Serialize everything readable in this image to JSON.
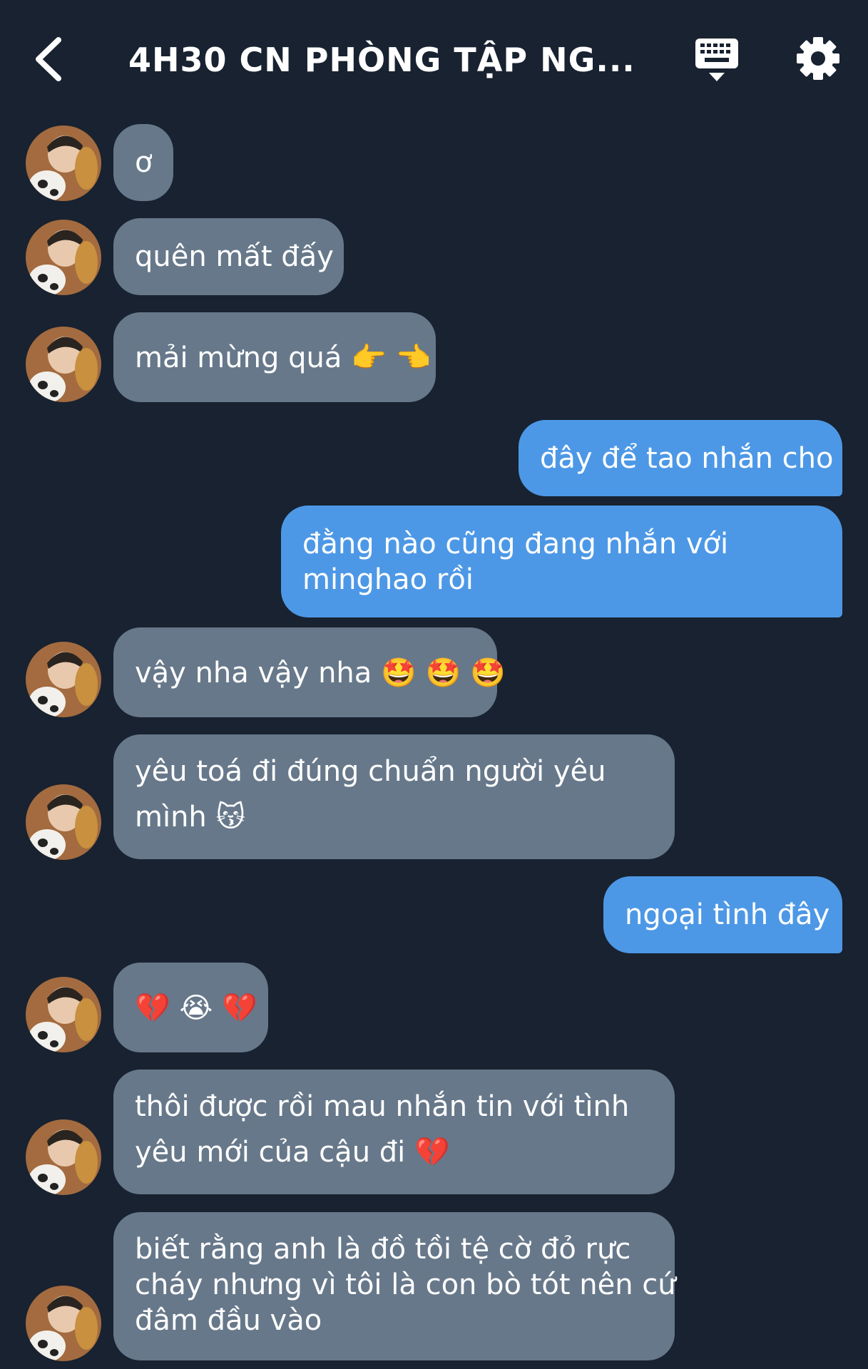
{
  "header": {
    "title": "4H30 CN PHÒNG TẬP NG...",
    "back_icon": "chevron-left-icon",
    "keyboard_icon": "keyboard-icon",
    "settings_icon": "gear-icon"
  },
  "colors": {
    "background": "#182230",
    "incoming_bubble": "#67788a",
    "outgoing_bubble": "#4d98e6",
    "text": "#ffffff"
  },
  "messages": [
    {
      "direction": "incoming",
      "lines": [
        "ơ"
      ]
    },
    {
      "direction": "incoming",
      "lines": [
        "quên mất đấy"
      ]
    },
    {
      "direction": "incoming",
      "lines": [
        "mải mừng quá 👉 👈"
      ]
    },
    {
      "direction": "outgoing",
      "lines": [
        "đây để tao nhắn cho"
      ]
    },
    {
      "direction": "outgoing",
      "lines": [
        "đằng nào cũng đang nhắn với",
        "minghao rồi"
      ]
    },
    {
      "direction": "incoming",
      "lines": [
        "vậy nha vậy nha 🤩 🤩 🤩"
      ]
    },
    {
      "direction": "incoming",
      "lines": [
        "yêu toá đi đúng chuẩn người yêu",
        "mình 😽"
      ]
    },
    {
      "direction": "outgoing",
      "lines": [
        "ngoại tình đây"
      ]
    },
    {
      "direction": "incoming",
      "lines": [
        "💔 😭 💔"
      ]
    },
    {
      "direction": "incoming",
      "lines": [
        "thôi được rồi mau nhắn tin với tình",
        "yêu mới của cậu đi 💔"
      ]
    },
    {
      "direction": "incoming",
      "lines": [
        "biết rằng anh là đồ tồi tệ cờ đỏ rực",
        "cháy nhưng vì tôi là con bò tót nên cứ",
        "đâm đầu vào"
      ]
    }
  ]
}
